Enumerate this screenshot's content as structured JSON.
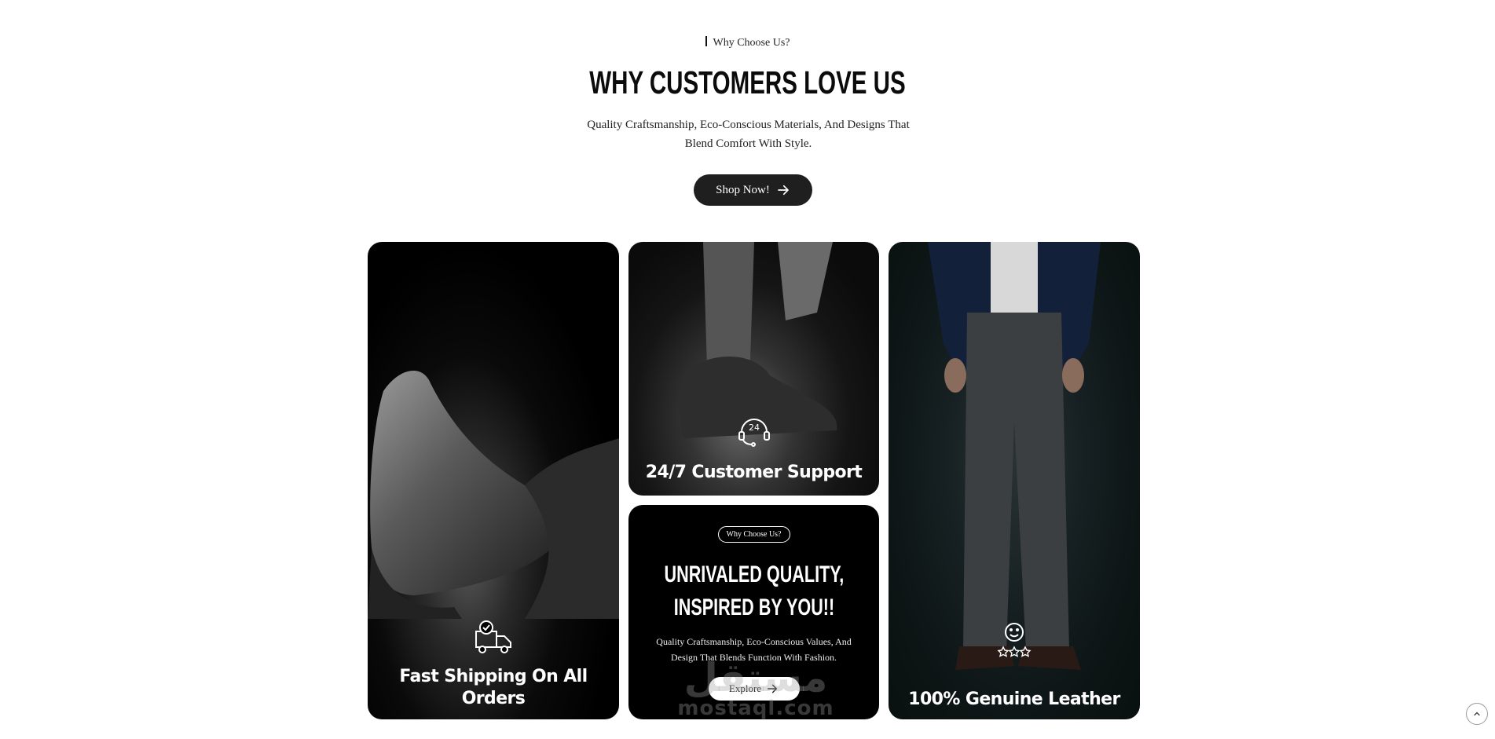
{
  "header": {
    "eyebrow": "Why Choose Us?",
    "title": "WHY CUSTOMERS LOVE US",
    "subtitle": "Quality Craftsmanship, Eco-Conscious Materials, And Designs That Blend Comfort With Style.",
    "cta_label": "Shop Now!"
  },
  "cards": {
    "shipping": {
      "label": "Fast Shipping On All Orders",
      "icon": "delivery-truck-icon"
    },
    "support": {
      "label": "24/7 Customer Support",
      "icon": "headset-24-icon",
      "icon_text": "24"
    },
    "quality": {
      "pill": "Why Choose Us?",
      "title_line1": "UNRIVALED QUALITY,",
      "title_line2": "INSPIRED BY YOU!!",
      "description": "Quality Craftsmanship, Eco-Conscious Values, And Design That Blends Function With Fashion.",
      "button_label": "Explore"
    },
    "leather": {
      "label": "100% Genuine Leather",
      "icon": "smiley-stars-icon"
    }
  },
  "watermark": {
    "arabic": "مستقل",
    "latin": "mostaql.com"
  },
  "colors": {
    "accent": "#1f1f1f",
    "background": "#ffffff",
    "card_bg": "#000000"
  }
}
